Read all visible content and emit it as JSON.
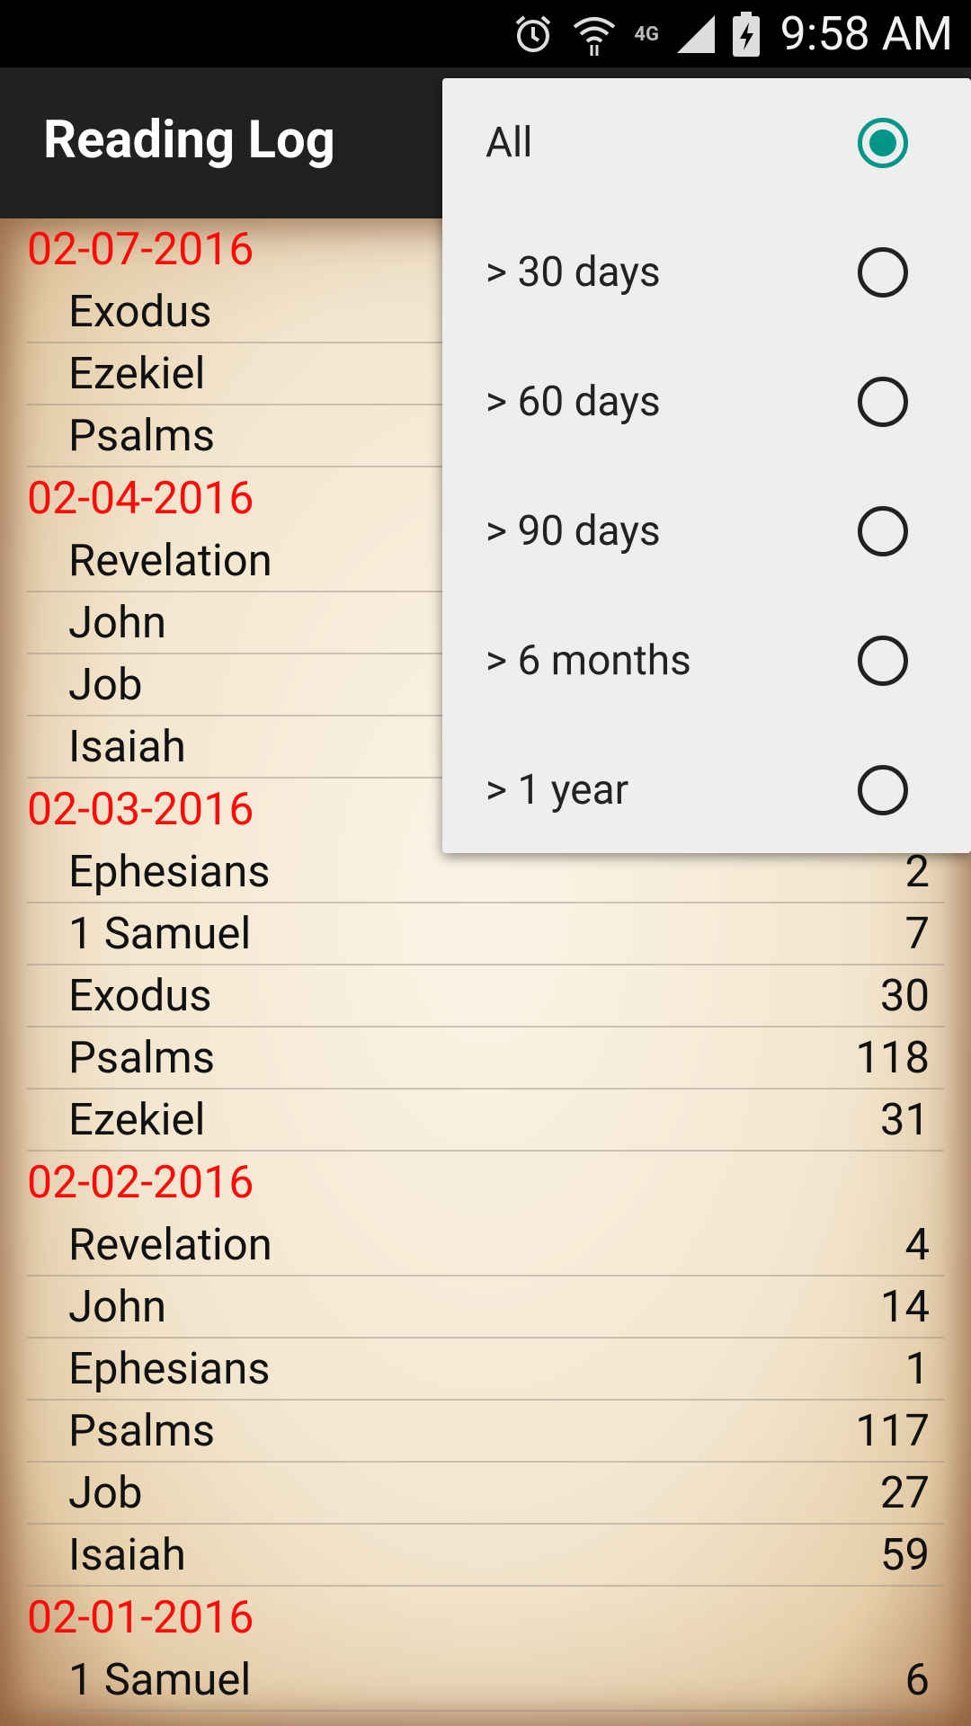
{
  "status_bar": {
    "time": "9:58 AM",
    "network": "4G",
    "icons": [
      "alarm-icon",
      "wifi-icon",
      "network-4g-icon",
      "signal-icon",
      "battery-charging-icon"
    ]
  },
  "app_bar": {
    "title": "Reading Log"
  },
  "filter_menu": {
    "options": [
      {
        "label": "All",
        "selected": true
      },
      {
        "label": "> 30 days",
        "selected": false
      },
      {
        "label": "> 60 days",
        "selected": false
      },
      {
        "label": "> 90 days",
        "selected": false
      },
      {
        "label": "> 6 months",
        "selected": false
      },
      {
        "label": "> 1 year",
        "selected": false
      }
    ]
  },
  "log": [
    {
      "date": "02-07-2016",
      "entries": [
        {
          "book": "Exodus",
          "chapter": ""
        },
        {
          "book": "Ezekiel",
          "chapter": ""
        },
        {
          "book": "Psalms",
          "chapter": ""
        }
      ]
    },
    {
      "date": "02-04-2016",
      "entries": [
        {
          "book": "Revelation",
          "chapter": ""
        },
        {
          "book": "John",
          "chapter": ""
        },
        {
          "book": "Job",
          "chapter": ""
        },
        {
          "book": "Isaiah",
          "chapter": ""
        }
      ]
    },
    {
      "date": "02-03-2016",
      "entries": [
        {
          "book": "Ephesians",
          "chapter": "2"
        },
        {
          "book": "1 Samuel",
          "chapter": "7"
        },
        {
          "book": "Exodus",
          "chapter": "30"
        },
        {
          "book": "Psalms",
          "chapter": "118"
        },
        {
          "book": "Ezekiel",
          "chapter": "31"
        }
      ]
    },
    {
      "date": "02-02-2016",
      "entries": [
        {
          "book": "Revelation",
          "chapter": "4"
        },
        {
          "book": "John",
          "chapter": "14"
        },
        {
          "book": "Ephesians",
          "chapter": "1"
        },
        {
          "book": "Psalms",
          "chapter": "117"
        },
        {
          "book": "Job",
          "chapter": "27"
        },
        {
          "book": "Isaiah",
          "chapter": "59"
        }
      ]
    },
    {
      "date": "02-01-2016",
      "entries": [
        {
          "book": "1 Samuel",
          "chapter": "6"
        }
      ]
    }
  ],
  "colors": {
    "date_text": "#ff0a0a",
    "app_bar": "#212121",
    "radio_selected": "#009688",
    "popup_bg": "#eeeeee"
  }
}
